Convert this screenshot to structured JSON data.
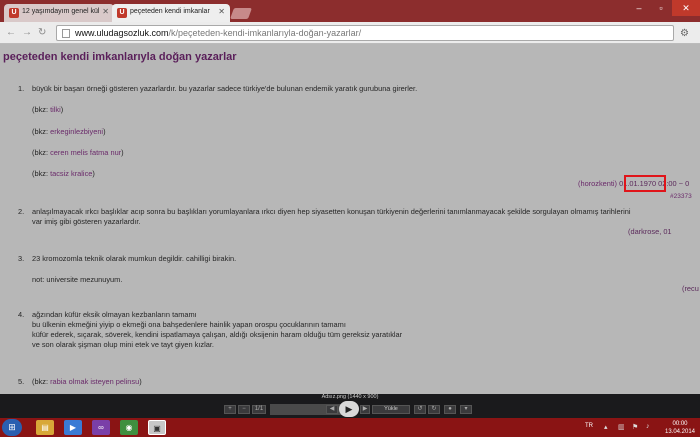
{
  "browser": {
    "tabs": [
      {
        "title": "12 yaşımdayım genel kül",
        "active": false
      },
      {
        "title": "peçeteden kendi imkanlar",
        "active": true
      }
    ],
    "url_host": "www.uludagsozluk.com",
    "url_path": "/k/peçeteden-kendi-imkanlarıyla-doğan-yazarlar/"
  },
  "page": {
    "title": "peçeteden kendi imkanlarıyla doğan yazarlar",
    "entries": [
      {
        "number": "1.",
        "lines": [
          {
            "prefix": "",
            "text": "büyük bir başarı örneği gösteren yazarlardır. bu yazarlar sadece türkiye'de bulunan endemik yaratık gurubuna girerler.",
            "link": ""
          },
          {
            "prefix": "(bkz: ",
            "text": "",
            "link": "tilki",
            "suffix": ")"
          },
          {
            "prefix": "(bkz: ",
            "text": "",
            "link": "erkeginlezbiyeni",
            "suffix": ")"
          },
          {
            "prefix": "(bkz: ",
            "text": "",
            "link": "ceren melis fatma nur",
            "suffix": ")"
          },
          {
            "prefix": "(bkz: ",
            "text": "",
            "link": "tacsiz kralice",
            "suffix": ")"
          }
        ],
        "author": "(horozkenti)",
        "date": "01.01.1970",
        "time": "02:00 ~ 0",
        "id": "#23373"
      },
      {
        "number": "2.",
        "lines": [
          {
            "prefix": "",
            "text": "anlaşılmayacak ırkcı başlıklar acıp sonra bu başlıkları yorumlayanlara ırkcı diyen hep siyasetten konuşan türkiyenin değerlerini tanımlanmayacak şekilde sorgulayan olmamış tarihlerini",
            "link": ""
          },
          {
            "prefix": "",
            "text": "var imiş gibi gösteren yazarlardır.",
            "link": ""
          }
        ],
        "author": "(darkrose, 01",
        "date": "",
        "time": "",
        "id": ""
      },
      {
        "number": "3.",
        "lines": [
          {
            "prefix": "",
            "text": "23 kromozomla teknik olarak mumkun degildir. cahilligi birakin.",
            "link": ""
          },
          {
            "prefix": "",
            "text": "not: universite mezunuyum.",
            "link": ""
          }
        ],
        "author": "(recu",
        "date": "",
        "time": "",
        "id": ""
      },
      {
        "number": "4.",
        "lines": [
          {
            "prefix": "",
            "text": "ağzından küfür eksik olmayan kezbanların tamamı",
            "link": ""
          },
          {
            "prefix": "",
            "text": "bu ülkenin ekmeğini yiyip o ekmeği ona bahşedenlere hainlik yapan orospu çocuklarının tamamı",
            "link": ""
          },
          {
            "prefix": "",
            "text": "küfür ederek, sıçarak, söverek, kendini ispatlamaya çalışan, aldığı oksijenin haram olduğu tüm gereksiz yaratıklar",
            "link": ""
          },
          {
            "prefix": "",
            "text": "ve son olarak şişman olup mini etek ve tayt giyen kızlar.",
            "link": ""
          }
        ],
        "author": "",
        "date": "",
        "time": "",
        "id": ""
      },
      {
        "number": "5.",
        "lines": [
          {
            "prefix": "(bkz: ",
            "text": "",
            "link": "rabia olmak isteyen pelinsu",
            "suffix": ")"
          }
        ],
        "author": "",
        "date": "",
        "time": "",
        "id": ""
      }
    ]
  },
  "viewer": {
    "caption": "Adsız.png (1440 x 900)",
    "counter": "1/1",
    "load_label": "Yükle"
  },
  "taskbar": {
    "language": "TR",
    "time": "00:00",
    "date": "13.04.2014"
  },
  "colors": {
    "tab_strip": "#8c2d2d",
    "link": "#6a2a6a",
    "highlight_box": "#e0141a",
    "taskbar": "#8a1414"
  }
}
